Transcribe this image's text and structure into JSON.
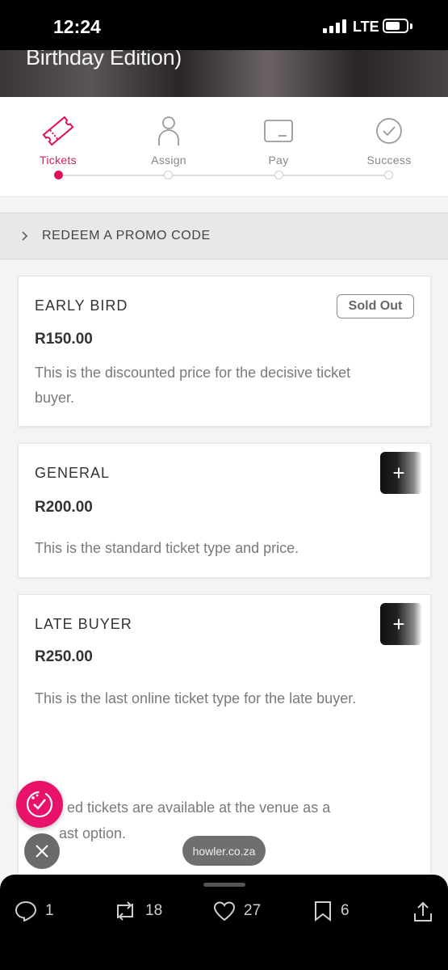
{
  "status_bar": {
    "time": "12:24",
    "network": "LTE"
  },
  "hero": {
    "title": "Birthday Edition)"
  },
  "stepper": {
    "steps": [
      {
        "label": "Tickets",
        "icon": "ticket-icon",
        "active": true
      },
      {
        "label": "Assign",
        "icon": "person-icon",
        "active": false
      },
      {
        "label": "Pay",
        "icon": "card-icon",
        "active": false
      },
      {
        "label": "Success",
        "icon": "check-circle-icon",
        "active": false
      }
    ],
    "active_color": "#e0115f"
  },
  "promo": {
    "label": "REDEEM A PROMO CODE"
  },
  "tickets": [
    {
      "name": "EARLY BIRD",
      "price": "R150.00",
      "description": "This is the discounted price for the decisive ticket buyer.",
      "badge": "Sold Out"
    },
    {
      "name": "GENERAL",
      "price": "R200.00",
      "description": "This is the standard ticket type and price.",
      "add_label": "+"
    },
    {
      "name": "LATE BUYER",
      "price": "R250.00",
      "description": "This is the last online ticket type for the late buyer.",
      "note": "ed tickets are available at the venue as a",
      "note2": "ast option.",
      "add_label": "+"
    }
  ],
  "overlay": {
    "url": "howler.co.za"
  },
  "bottom_bar": {
    "replies": "1",
    "retweets": "18",
    "likes": "27",
    "bookmarks": "6"
  }
}
